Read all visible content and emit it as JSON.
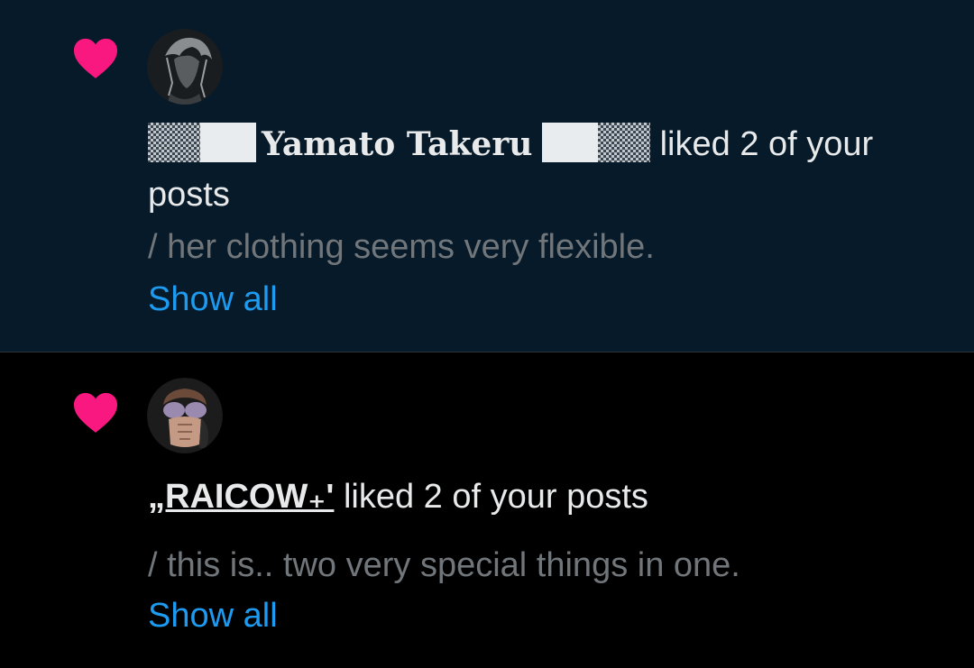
{
  "colors": {
    "unread_bg": "#061a29",
    "read_bg": "#000000",
    "heart": "#f91880",
    "link": "#1d9bf0",
    "primary_text": "#e7e9ea",
    "secondary_text": "#71767b"
  },
  "notifications": [
    {
      "icon": "heart-icon",
      "display_name": "Yamato Takeru",
      "action_text": " liked 2 of your posts",
      "preview": "/ her clothing seems very flexible.",
      "show_all": "Show all"
    },
    {
      "icon": "heart-icon",
      "display_name": "„RAICOW₊'",
      "action_text": " liked 2 of your posts",
      "preview": "/ this is.. two very special things in one.",
      "show_all": "Show all"
    }
  ]
}
